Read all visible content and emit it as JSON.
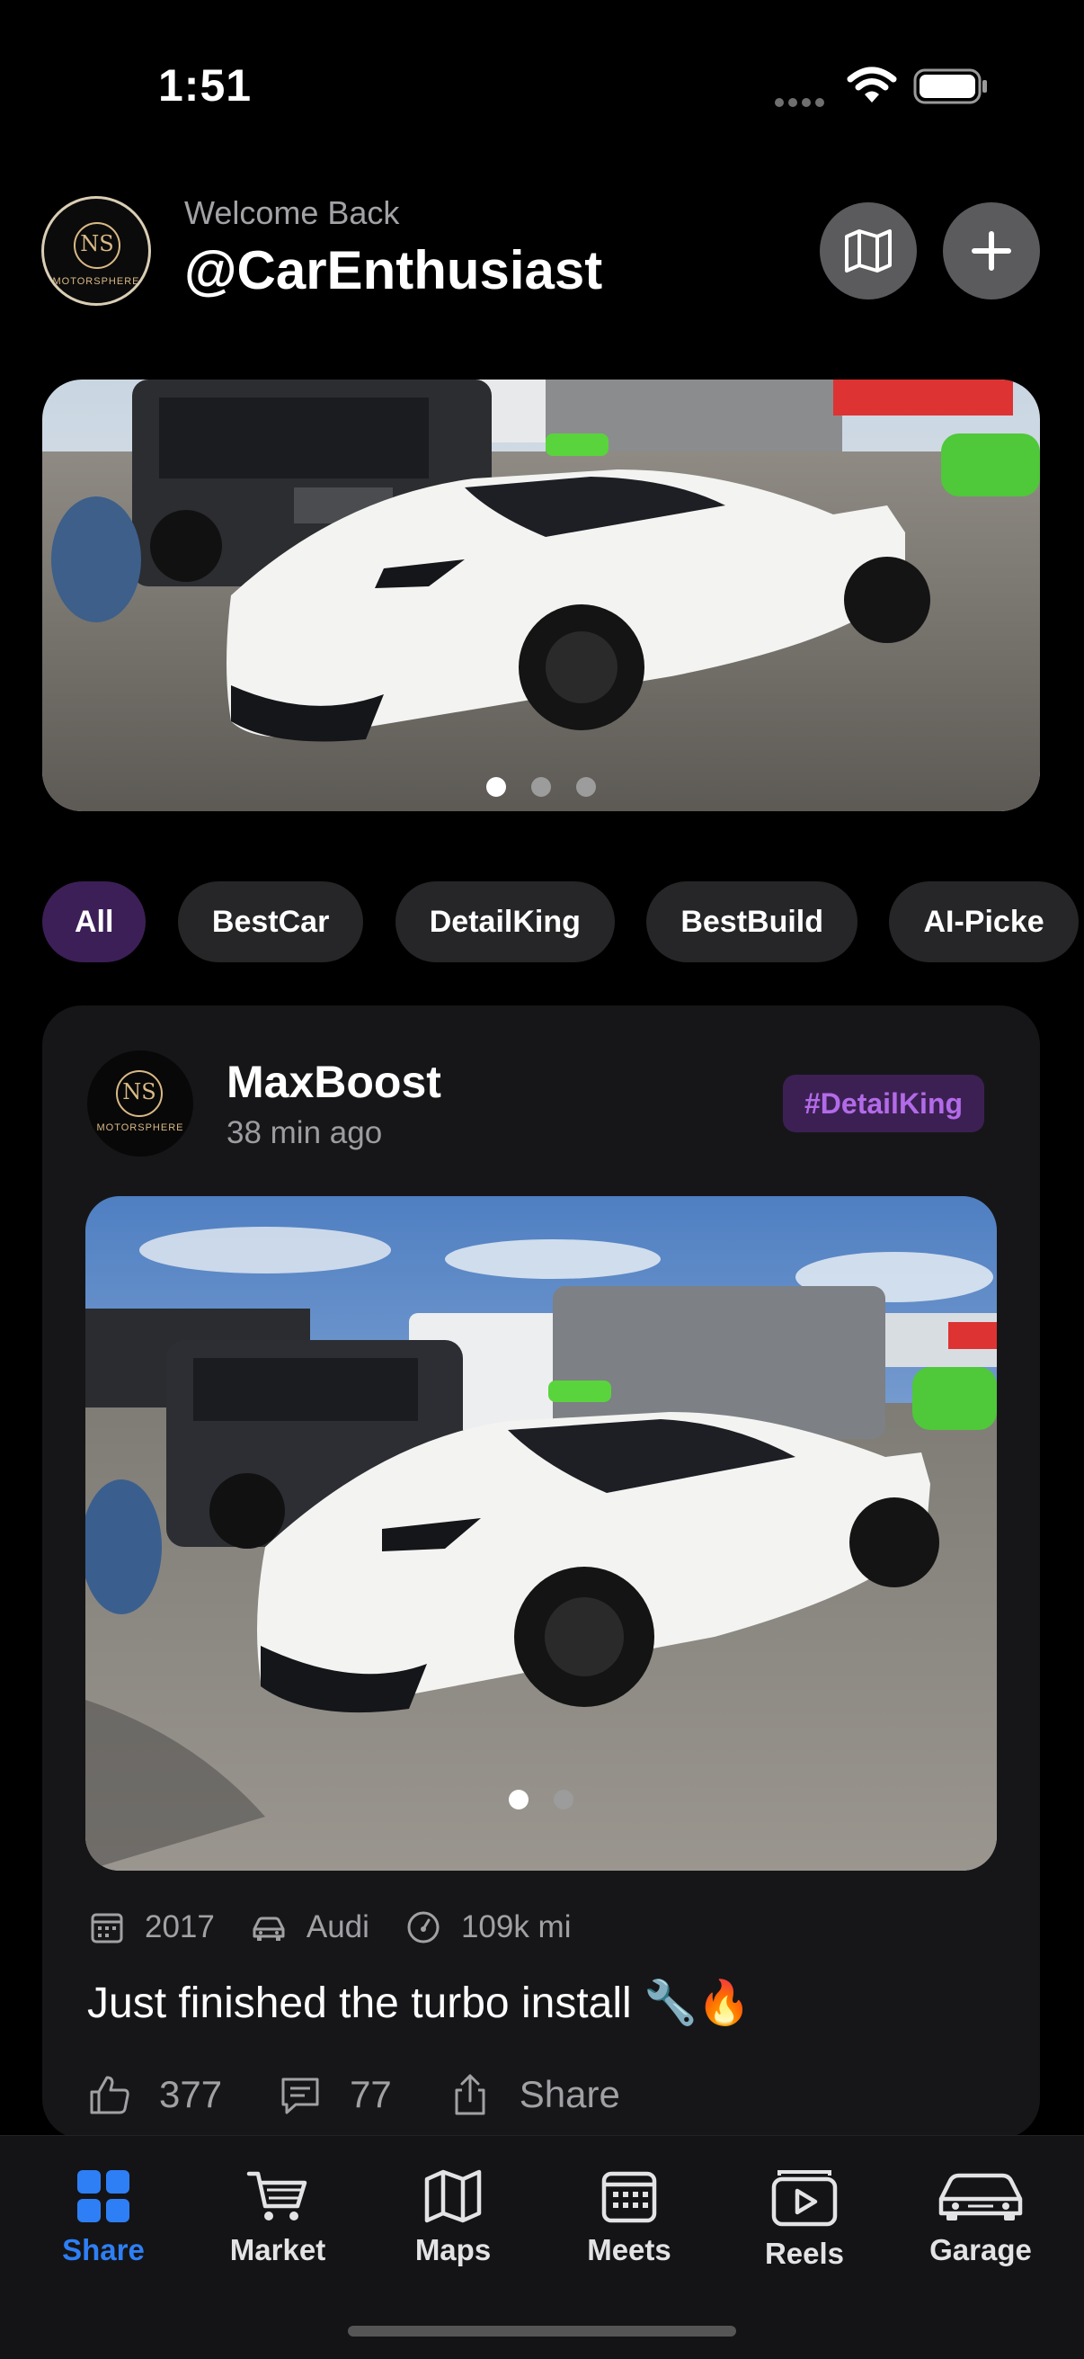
{
  "status_bar": {
    "time": "1:51"
  },
  "header": {
    "welcome": "Welcome Back",
    "username": "@CarEnthusiast",
    "logo_monogram": "NS",
    "logo_word": "MOTORSPHERE",
    "map_icon": "map-icon",
    "add_icon": "plus-icon"
  },
  "hero": {
    "slide_count": 3,
    "active_slide": 1
  },
  "filters": {
    "chips": [
      "All",
      "BestCar",
      "DetailKing",
      "BestBuild",
      "AI-Picke"
    ],
    "active": "All"
  },
  "post": {
    "author": "MaxBoost",
    "time": "38 min ago",
    "tag": "#DetailKing",
    "image_slides": 2,
    "active_slide": 1,
    "year": "2017",
    "make": "Audi",
    "mileage": "109k mi",
    "caption": "Just finished the turbo install 🔧🔥",
    "likes": "377",
    "comments": "77",
    "share_label": "Share"
  },
  "tabbar": {
    "tabs": [
      {
        "label": "Share",
        "icon": "grid-icon"
      },
      {
        "label": "Market",
        "icon": "cart-icon"
      },
      {
        "label": "Maps",
        "icon": "map-icon"
      },
      {
        "label": "Meets",
        "icon": "calendar-icon"
      },
      {
        "label": "Reels",
        "icon": "play-icon"
      },
      {
        "label": "Garage",
        "icon": "car-icon"
      }
    ],
    "active": "Share"
  },
  "colors": {
    "accent_blue": "#2e7ff5",
    "tag_purple": "#b26be8",
    "chip_active_bg": "#3d1f57",
    "card_bg": "#161618"
  }
}
